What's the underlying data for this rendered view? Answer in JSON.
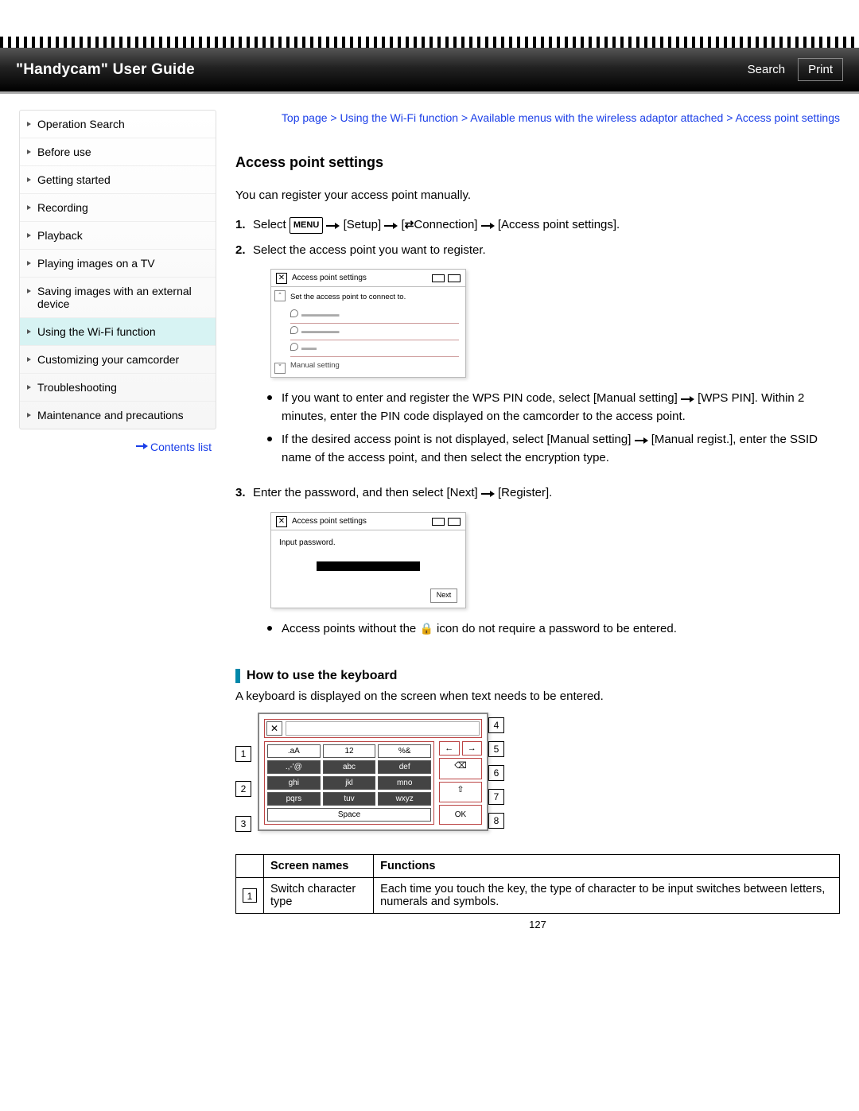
{
  "header": {
    "title": "\"Handycam\" User Guide",
    "search": "Search",
    "print": "Print"
  },
  "sidebar": {
    "items": [
      "Operation Search",
      "Before use",
      "Getting started",
      "Recording",
      "Playback",
      "Playing images on a TV",
      "Saving images with an external device",
      "Using the Wi-Fi function",
      "Customizing your camcorder",
      "Troubleshooting",
      "Maintenance and precautions"
    ],
    "active_index": 7,
    "contents_link": "Contents list"
  },
  "breadcrumb": "Top page > Using the Wi-Fi function > Available menus with the wireless adaptor attached > Access point settings",
  "page_title": "Access point settings",
  "intro": "You can register your access point manually.",
  "step1": {
    "prefix": "Select",
    "menu": "MENU",
    "setup": "[Setup]",
    "connection": "Connection]",
    "aps": "[Access point settings]."
  },
  "step2": "Select the access point you want to register.",
  "mock1": {
    "title": "Access point settings",
    "caption": "Set the access point to connect to.",
    "manual": "Manual setting"
  },
  "bullets1": [
    "If you want to enter and register the WPS PIN code, select [Manual setting] → [WPS PIN]. Within 2 minutes, enter the PIN code displayed on the camcorder to the access point.",
    "If the desired access point is not displayed, select [Manual setting] → [Manual regist.], enter the SSID name of the access point, and then select the encryption type."
  ],
  "step3": "Enter the password, and then select [Next] → [Register].",
  "mock2": {
    "title": "Access point settings",
    "input_label": "Input password.",
    "next": "Next"
  },
  "bullets2_pre": "Access points without the",
  "bullets2_post": "icon do not require a password to be entered.",
  "keyboard_heading": "How to use the keyboard",
  "keyboard_intro": "A keyboard is displayed on the screen when text needs to be entered.",
  "kb": {
    "keys_row1": [
      ".aA",
      "12",
      "%&"
    ],
    "keys_row2": [
      ".,-'@",
      "abc",
      "def"
    ],
    "keys_row3": [
      "ghi",
      "jkl",
      "mno"
    ],
    "keys_row4": [
      "pqrs",
      "tuv",
      "wxyz"
    ],
    "space": "Space",
    "ok": "OK"
  },
  "table": {
    "h1": "Screen names",
    "h2": "Functions",
    "row1_idx": "1",
    "row1_name": "Switch character type",
    "row1_fn": "Each time you touch the key, the type of character to be input switches between letters, numerals and symbols."
  },
  "page_number": "127"
}
